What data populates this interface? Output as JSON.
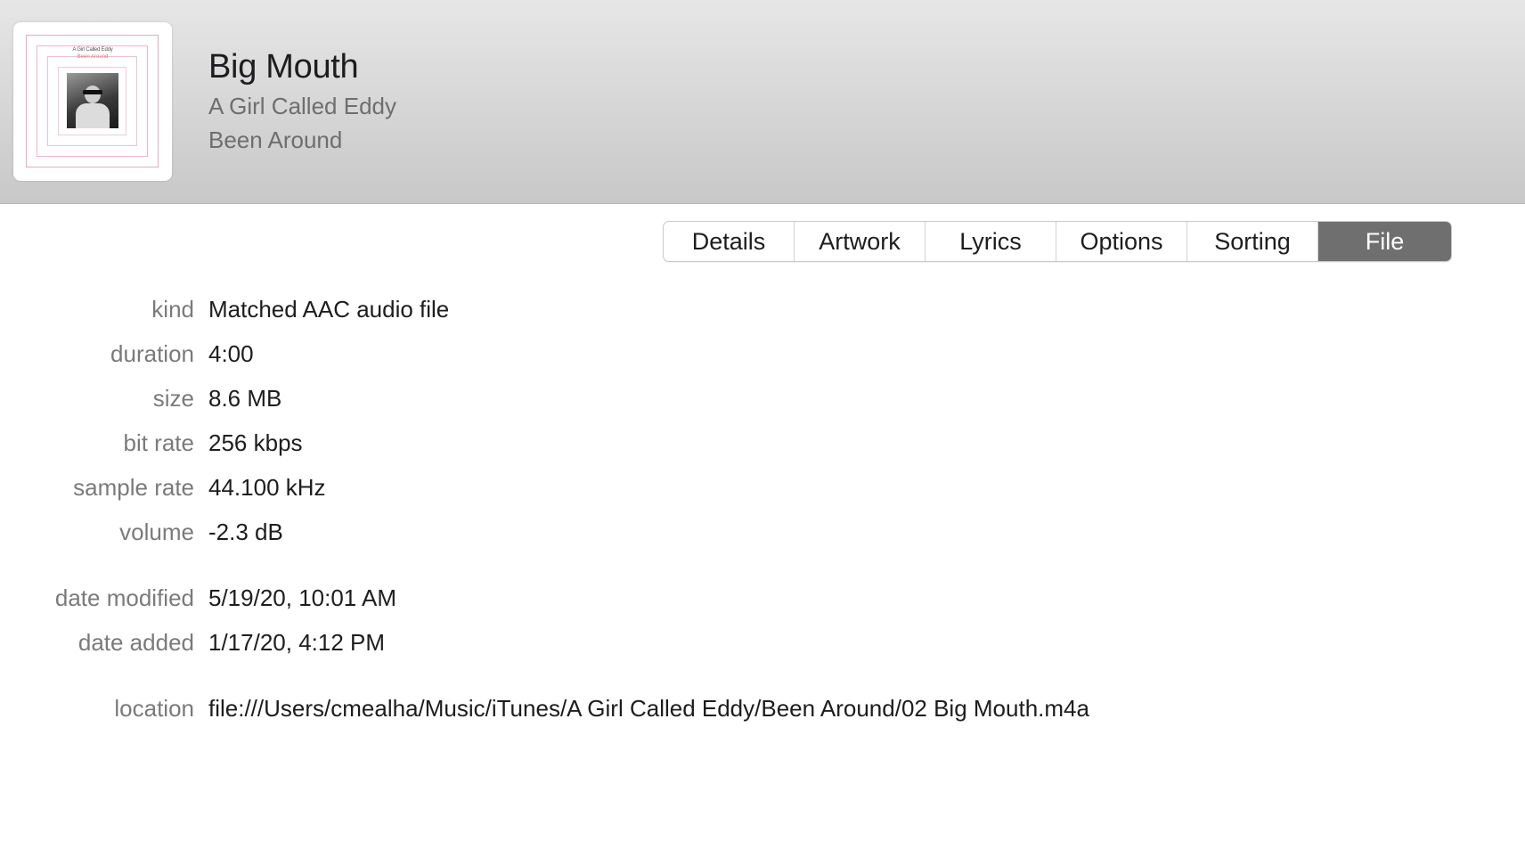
{
  "header": {
    "title": "Big Mouth",
    "artist": "A Girl Called Eddy",
    "album": "Been Around",
    "artwork": {
      "line1": "A Girl Called Eddy",
      "line2": "Been Around"
    }
  },
  "tabs": [
    {
      "label": "Details",
      "active": false
    },
    {
      "label": "Artwork",
      "active": false
    },
    {
      "label": "Lyrics",
      "active": false
    },
    {
      "label": "Options",
      "active": false
    },
    {
      "label": "Sorting",
      "active": false
    },
    {
      "label": "File",
      "active": true
    }
  ],
  "fields": {
    "kind": {
      "label": "kind",
      "value": "Matched AAC audio file"
    },
    "duration": {
      "label": "duration",
      "value": "4:00"
    },
    "size": {
      "label": "size",
      "value": "8.6 MB"
    },
    "bit_rate": {
      "label": "bit rate",
      "value": "256 kbps"
    },
    "sample_rate": {
      "label": "sample rate",
      "value": "44.100 kHz"
    },
    "volume": {
      "label": "volume",
      "value": "-2.3 dB"
    },
    "date_modified": {
      "label": "date modified",
      "value": "5/19/20, 10:01 AM"
    },
    "date_added": {
      "label": "date added",
      "value": "1/17/20, 4:12 PM"
    },
    "location": {
      "label": "location",
      "value": "file:///Users/cmealha/Music/iTunes/A Girl Called Eddy/Been Around/02 Big Mouth.m4a"
    }
  },
  "colors": {
    "active_tab": "#6f6f6f",
    "label_text": "#7a7a7a"
  }
}
